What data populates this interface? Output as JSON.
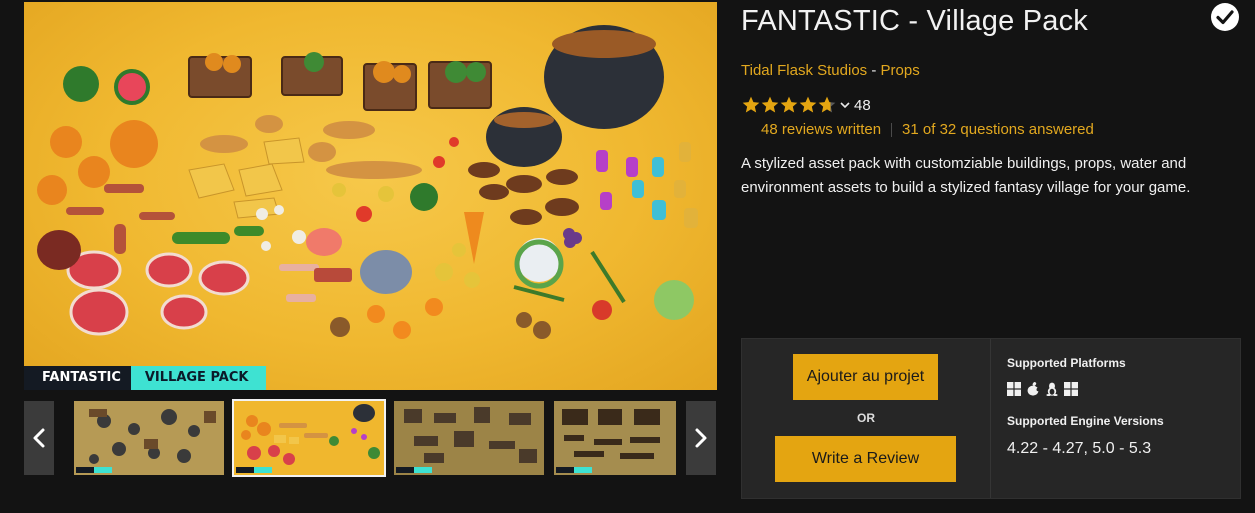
{
  "product": {
    "title": "FANTASTIC - Village Pack",
    "seller": "Tidal Flask Studios",
    "separator": " - ",
    "category": "Props",
    "rating_count": "48",
    "reviews_written": "48 reviews written",
    "questions_answered": "31 of 32 questions answered",
    "description": "A stylized asset pack with customziable buildings, props, water and environment assets to build a stylized fantasy village for your game.",
    "owned_icon": "check-circle-icon"
  },
  "gallery": {
    "badge_brand": "FANTASTIC",
    "badge_pack": "VILLAGE PACK",
    "prev_icon": "chevron-left-icon",
    "next_icon": "chevron-right-icon"
  },
  "purchase": {
    "add_label": "Ajouter au projet",
    "or_label": "OR",
    "review_label": "Write a Review",
    "platforms_heading": "Supported Platforms",
    "platforms": [
      "windows-icon",
      "apple-icon",
      "linux-icon",
      "windows-icon"
    ],
    "engine_heading": "Supported Engine Versions",
    "engine_versions": "4.22 - 4.27, 5.0 - 5.3"
  },
  "colors": {
    "accent": "#e4a511",
    "link": "#e2a81f",
    "background": "#131313",
    "panel": "#262626",
    "badge_teal": "#3ee2d2"
  }
}
